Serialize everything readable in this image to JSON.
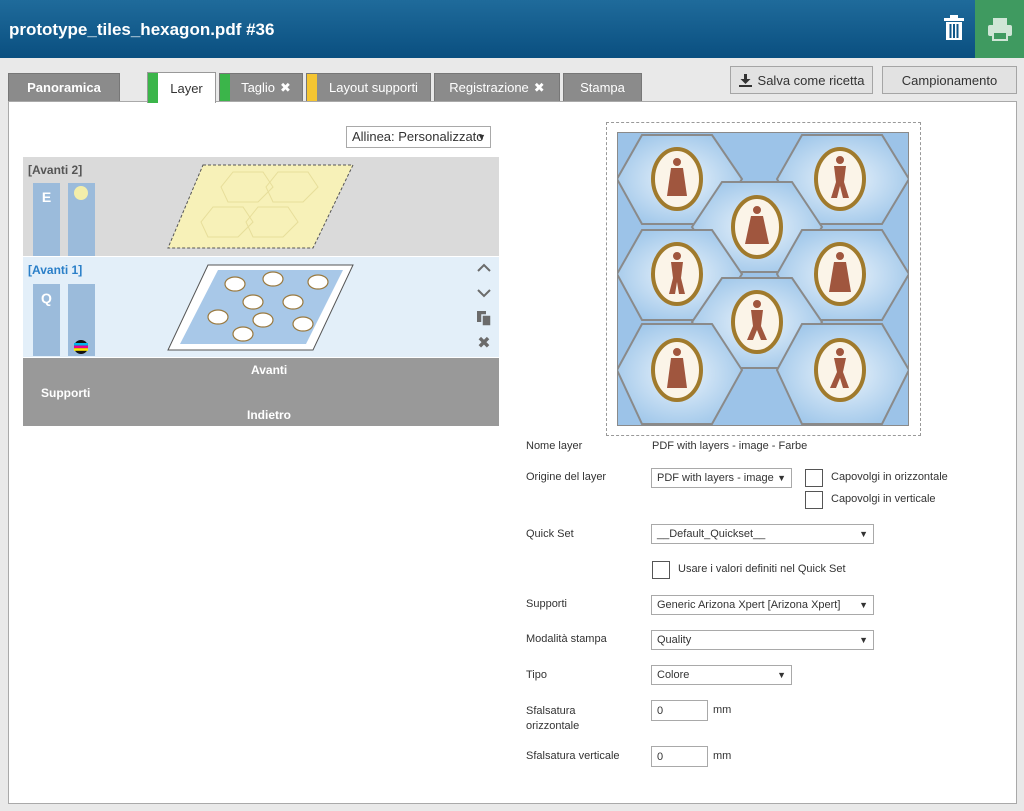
{
  "header": {
    "title": "prototype_tiles_hexagon.pdf #36"
  },
  "tabs": [
    {
      "label": "Panoramica"
    },
    {
      "label": "Layer"
    },
    {
      "label": "Taglio"
    },
    {
      "label": "Layout supporti"
    },
    {
      "label": "Registrazione"
    },
    {
      "label": "Stampa"
    }
  ],
  "actions": {
    "save_recipe": "Salva come ricetta",
    "sampling": "Campionamento"
  },
  "align": {
    "value": "Allinea: Personalizzato"
  },
  "layers": [
    {
      "label": "[Avanti 2]",
      "mode_letter": "E"
    },
    {
      "label": "[Avanti 1]",
      "mode_letter": "Q"
    }
  ],
  "supports_block": {
    "front": "Avanti",
    "label": "Supporti",
    "back": "Indietro"
  },
  "form": {
    "layer_name_label": "Nome layer",
    "layer_name_value": "PDF with layers - image - Farbe",
    "layer_origin_label": "Origine del layer",
    "layer_origin_value": "PDF with layers - image",
    "flip_h_label": "Capovolgi in orizzontale",
    "flip_v_label": "Capovolgi in verticale",
    "quickset_label": "Quick Set",
    "quickset_value": "__Default_Quickset__",
    "use_quickset_label": "Usare i valori definiti nel Quick Set",
    "media_label": "Supporti",
    "media_value": "Generic Arizona Xpert [Arizona Xpert]",
    "print_mode_label": "Modalità stampa",
    "print_mode_value": "Quality",
    "type_label": "Tipo",
    "type_value": "Colore",
    "offset_h_label_1": "Sfalsatura",
    "offset_h_label_2": "orizzontale",
    "offset_h_value": "0",
    "offset_v_label": "Sfalsatura verticale",
    "offset_v_value": "0",
    "unit": "mm"
  },
  "colors": {
    "header": "#0a4f80",
    "print_button": "#3f9a60",
    "tab_green": "#3bb54a",
    "tab_yellow": "#f5c531",
    "layer_blue": "#9bbbdb"
  }
}
